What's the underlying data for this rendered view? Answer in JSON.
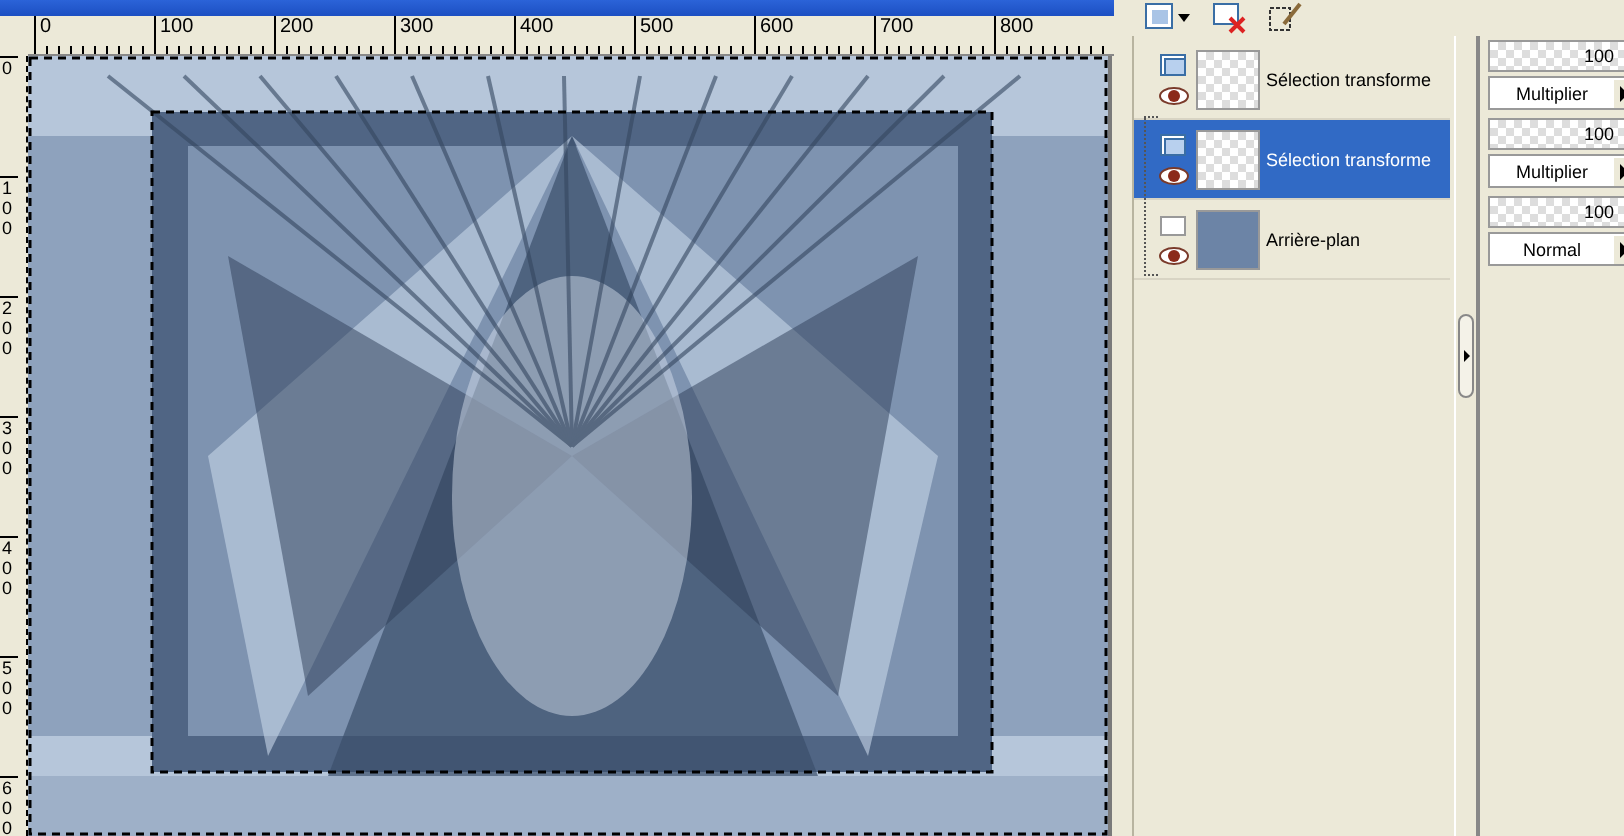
{
  "rulers": {
    "horizontal": [
      "0",
      "100",
      "200",
      "300",
      "400",
      "500",
      "600",
      "700",
      "800"
    ],
    "vertical": [
      "0",
      "100",
      "200",
      "300",
      "400",
      "500",
      "600"
    ]
  },
  "layers": [
    {
      "name": "Sélection transforme",
      "kind": "raster",
      "selected": false,
      "visible": true,
      "level": 1,
      "opacity": "100",
      "blend": "Multiplier"
    },
    {
      "name": "Sélection transforme",
      "kind": "raster",
      "selected": true,
      "visible": true,
      "level": 1,
      "opacity": "100",
      "blend": "Multiplier"
    },
    {
      "name": "Arrière-plan",
      "kind": "background",
      "selected": false,
      "visible": true,
      "level": 1,
      "opacity": "100",
      "blend": "Normal"
    }
  ]
}
